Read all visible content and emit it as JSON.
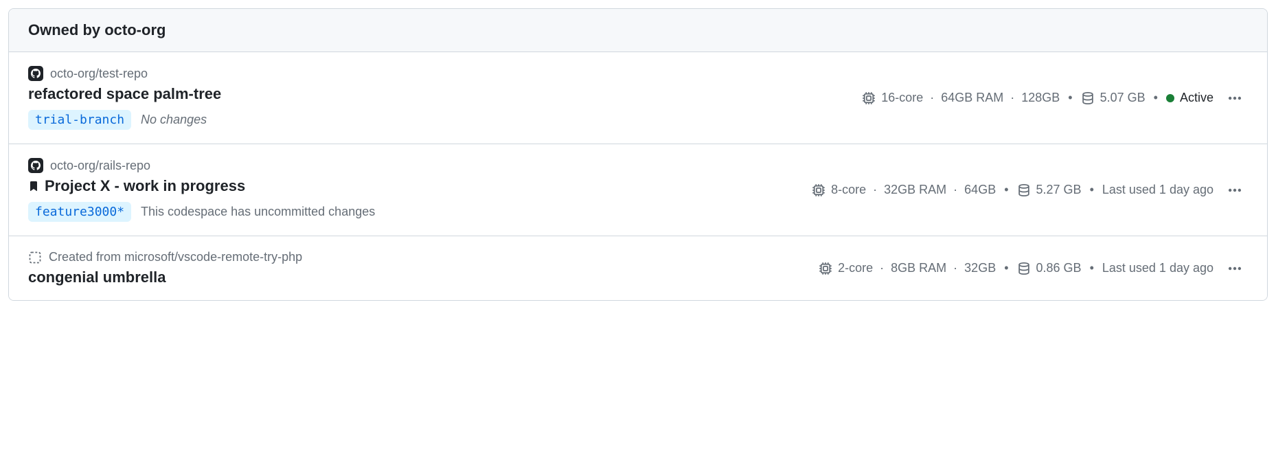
{
  "header": {
    "title": "Owned by octo-org"
  },
  "codespaces": [
    {
      "repo": "octo-org/test-repo",
      "name": "refactored space palm-tree",
      "bookmarked": false,
      "branch": "trial-branch",
      "changes": "No changes",
      "changes_style": "italic",
      "cpu_label": "16-core",
      "ram_label": "64GB RAM",
      "disk_label": "128GB",
      "storage_used": "5.07 GB",
      "status_label": "Active",
      "status_kind": "active",
      "show_template_origin": false
    },
    {
      "repo": "octo-org/rails-repo",
      "name": "Project X - work in progress",
      "bookmarked": true,
      "branch": "feature3000*",
      "changes": "This codespace has uncommitted changes",
      "changes_style": "plain",
      "cpu_label": "8-core",
      "ram_label": "32GB RAM",
      "disk_label": "64GB",
      "storage_used": "5.27 GB",
      "status_label": "Last used 1 day ago",
      "status_kind": "idle",
      "show_template_origin": false
    },
    {
      "template_origin": "Created from microsoft/vscode-remote-try-php",
      "name": "congenial umbrella",
      "bookmarked": false,
      "branch": null,
      "changes": null,
      "cpu_label": "2-core",
      "ram_label": "8GB RAM",
      "disk_label": "32GB",
      "storage_used": "0.86 GB",
      "status_label": "Last used 1 day ago",
      "status_kind": "idle",
      "show_template_origin": true
    }
  ]
}
